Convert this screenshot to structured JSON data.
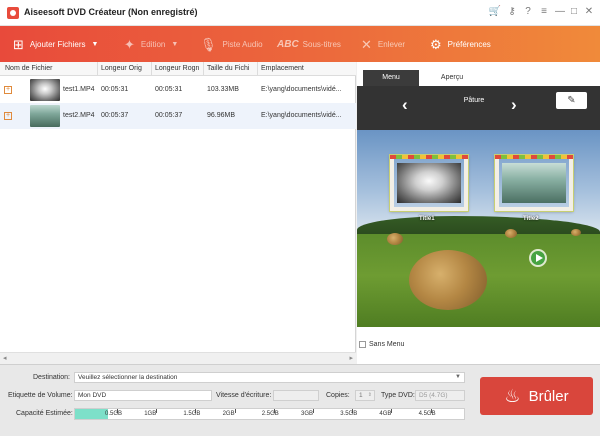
{
  "titlebar": {
    "title": "Aiseesoft DVD Créateur (Non enregistré)",
    "icons": [
      "cart-icon",
      "key-icon",
      "help-icon",
      "menu-icon",
      "minimize-icon",
      "restore-icon",
      "close-icon"
    ],
    "glyphs": {
      "cart": "🛒",
      "key": "⚷",
      "help": "?",
      "menu": "≡",
      "minimize": "—",
      "restore": "□",
      "close": "✕"
    }
  },
  "toolbar": {
    "add_files": "Ajouter Fichiers",
    "edition": "Edition",
    "audio": "Piste Audio",
    "subtitles_prefix": "ABC",
    "subtitles": "Sous-titres",
    "remove": "Enlever",
    "preferences": "Préférences"
  },
  "filelist": {
    "headers": [
      "Nom de Fichier",
      "Longeur Orig",
      "Longeur Rogn",
      "Taille du Fichi",
      "Emplacement"
    ],
    "rows": [
      {
        "name": "test1.MP4",
        "orig": "00:05:31",
        "trim": "00:05:31",
        "size": "103.33MB",
        "location": "E:\\yang\\documents\\vidé..."
      },
      {
        "name": "test2.MP4",
        "orig": "00:05:37",
        "trim": "00:05:37",
        "size": "96.96MB",
        "location": "E:\\yang\\documents\\vidé..."
      }
    ],
    "expand_glyph": "+"
  },
  "preview": {
    "tabs": [
      "Menu",
      "Aperçu"
    ],
    "theme": "Pâture",
    "prev_glyph": "‹",
    "next_glyph": "›",
    "edit_glyph": "✎",
    "titles": [
      "Title1",
      "Title2"
    ],
    "no_menu": "Sans Menu"
  },
  "bottom": {
    "destination_label": "Destination:",
    "destination_value": "Veuillez sélectionner la destination",
    "volume_label": "Etiquette de Volume:",
    "volume_value": "Mon DVD",
    "speed_label": "Vitesse d'écriture:",
    "copies_label": "Copies:",
    "copies_value": "1",
    "dvd_type_label": "Type DVD:",
    "dvd_type_value": "D5 (4.7G)",
    "capacity_label": "Capacité Estimée:",
    "capacity_ticks": [
      "0.5GB",
      "1GB",
      "1.5GB",
      "2GB",
      "2.5GB",
      "3GB",
      "3.5GB",
      "4GB",
      "4.5GB"
    ],
    "capacity_used_fraction": 0.085,
    "burn_label": "Brûler"
  },
  "colors": {
    "accent": "#e84a3b",
    "burn": "#d9463c",
    "capacity": "#7de0c9"
  }
}
